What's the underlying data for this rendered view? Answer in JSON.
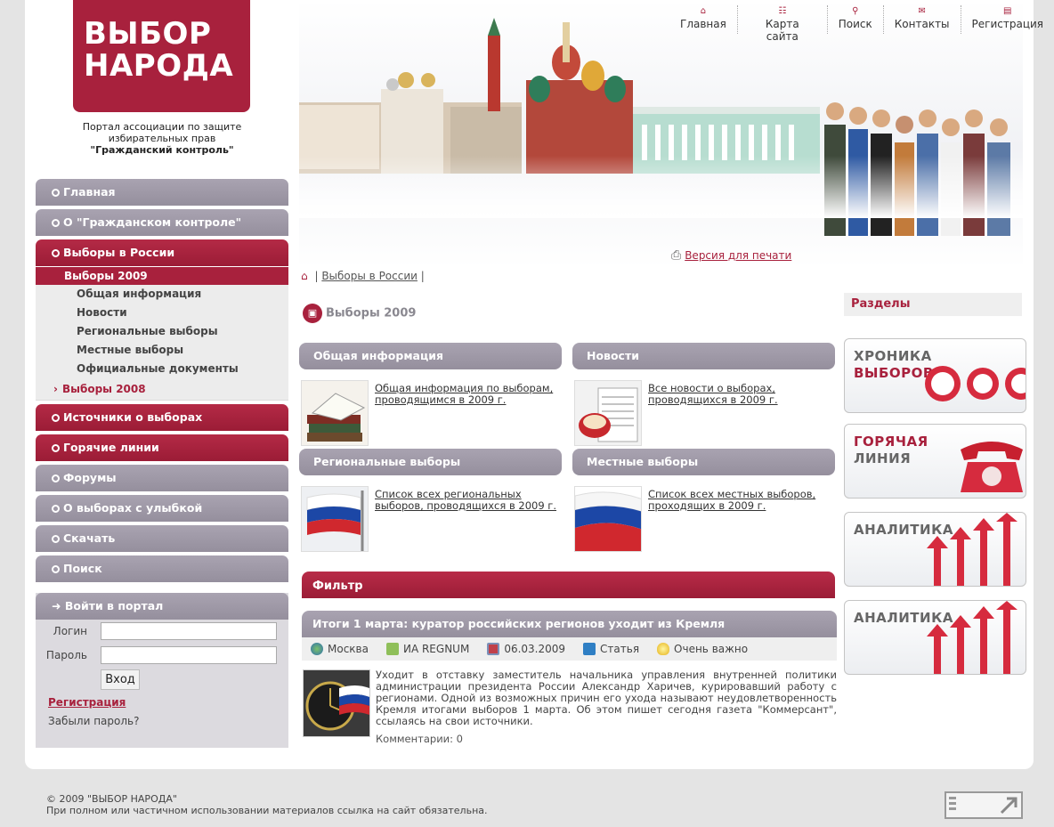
{
  "logo": {
    "line1": "ВЫБОР",
    "line2": "НАРОДА"
  },
  "tagline": {
    "line1": "Портал ассоциации по защите",
    "line2": "избирательных прав",
    "bold": "\"Гражданский контроль\""
  },
  "topnav": [
    {
      "label": "Главная",
      "icon": "home-icon"
    },
    {
      "label": "Карта сайта",
      "icon": "sitemap-icon"
    },
    {
      "label": "Поиск",
      "icon": "search-icon"
    },
    {
      "label": "Контакты",
      "icon": "mail-icon"
    },
    {
      "label": "Регистрация",
      "icon": "register-icon"
    }
  ],
  "nav": {
    "items": [
      "Главная",
      "О \"Гражданском контроле\"",
      "Выборы в России",
      "Источники о выборах",
      "Горячие линии",
      "Форумы",
      "О выборах с улыбкой",
      "Скачать",
      "Поиск"
    ],
    "sub_active": "Выборы 2009",
    "sub_items": [
      "Общая информация",
      "Новости",
      "Региональные выборы",
      "Местные выборы",
      "Официальные документы"
    ],
    "sub_other": "Выборы 2008"
  },
  "login": {
    "title": "Войти в портал",
    "login_label": "Логин",
    "password_label": "Пароль",
    "login_value": "",
    "password_value": "",
    "submit": "Вход",
    "register": "Регистрация",
    "forgot": "Забыли пароль?"
  },
  "print_link": "Версия для печати",
  "breadcrumb": {
    "sep1": "|",
    "link": "Выборы в России",
    "sep2": "|"
  },
  "page_title": "Выборы 2009",
  "sections": [
    {
      "title": "Общая информация",
      "link": "Общая информация по выборам, проводящимся в 2009 г."
    },
    {
      "title": "Новости",
      "link": "Все новости о выборах, проводящихся в 2009 г."
    },
    {
      "title": "Региональные выборы",
      "link": "Список всех региональных выборов, проводящихся в 2009 г."
    },
    {
      "title": "Местные выборы",
      "link": "Список всех местных выборов, проходящих в 2009 г."
    }
  ],
  "filter": "Фильтр",
  "news": {
    "title": "Итоги 1 марта: куратор российских регионов уходит из Кремля",
    "meta": {
      "city": "Москва",
      "source": "ИА REGNUM",
      "date": "06.03.2009",
      "type": "Статья",
      "importance": "Очень важно"
    },
    "text": "Уходит в отставку заместитель начальника управления внутренней политики администрации президента России Александр Харичев, курировавший работу с регионами. Одной из возможных причин его ухода называют неудовлетворенность Кремля итогами выборов 1 марта. Об этом пишет сегодня газета \"Коммерсант\", ссылаясь на свои источники.",
    "comments": "Комментарии: 0"
  },
  "sidebar_right": {
    "title": "Разделы",
    "promos": [
      {
        "line1": "ХРОНИКА",
        "line2": "ВЫБОРОВ"
      },
      {
        "line1": "ГОРЯЧАЯ",
        "line2": "ЛИНИЯ"
      },
      {
        "line1": "АНАЛИТИКА",
        "line2": ""
      },
      {
        "line1": "АНАЛИТИКА",
        "line2": ""
      }
    ]
  },
  "footer": {
    "copyright": "© 2009 \"ВЫБОР НАРОДА\"",
    "notice": "При полном или частичном использовании материалов ссылка на сайт обязательна."
  },
  "colors": {
    "brand": "#a8213d",
    "nav_gray": "#a09aa8"
  }
}
